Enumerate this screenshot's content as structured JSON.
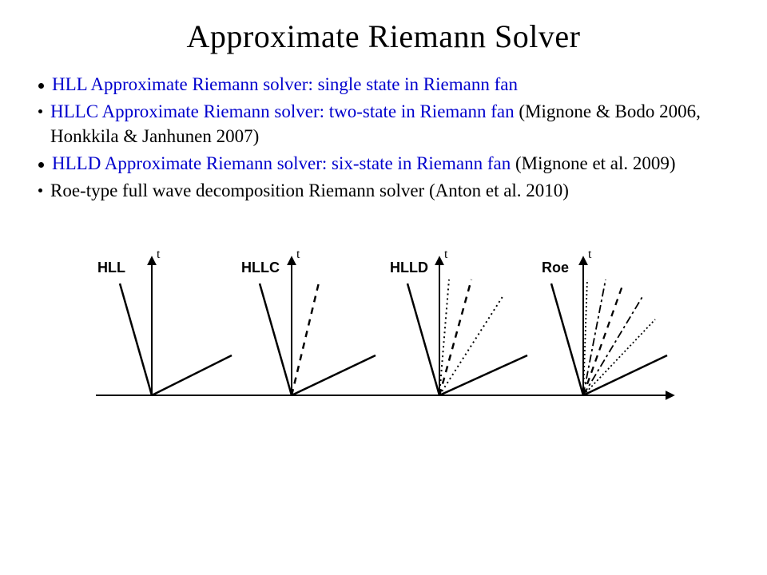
{
  "title": "Approximate Riemann Solver",
  "bullets": {
    "hll": {
      "blue": "HLL Approximate Riemann solver: single state in Riemann fan",
      "tail": ""
    },
    "hllc": {
      "blue": "HLLC Approximate Riemann solver: two-state in Riemann fan ",
      "tail": "(Mignone & Bodo 2006, Honkkila & Janhunen 2007)"
    },
    "hlld": {
      "blue": "HLLD Approximate Riemann solver: six-state in Riemann fan ",
      "tail": "(Mignone et al. 2009)"
    },
    "roe": {
      "blue": "",
      "tail": "Roe-type full wave decomposition Riemann solver (Anton et al. 2010)"
    }
  },
  "figure": {
    "panels": [
      "HLL",
      "HLLC",
      "HLLD",
      "Roe"
    ],
    "yaxis": "t"
  }
}
